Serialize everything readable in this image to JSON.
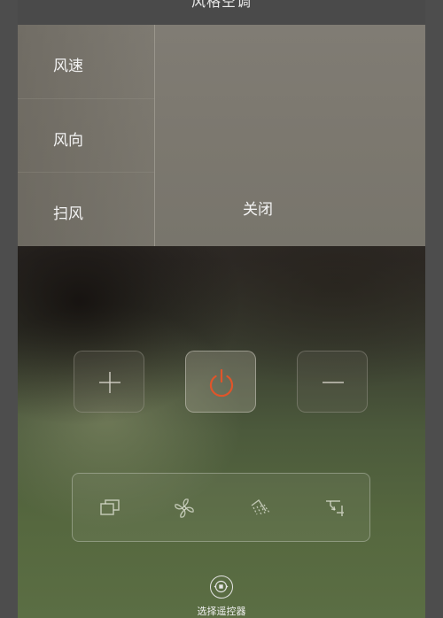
{
  "header": {
    "title": "风格空调"
  },
  "menu": {
    "items": [
      {
        "label": "风速"
      },
      {
        "label": "风向"
      },
      {
        "label": "扫风"
      }
    ],
    "selected_value": "关闭"
  },
  "controls": {
    "increase_icon": "plus-icon",
    "power_icon": "power-icon",
    "decrease_icon": "minus-icon",
    "power_color": "#e0552a"
  },
  "modes": {
    "icons": [
      "window-mode-icon",
      "fan-icon",
      "swing-icon",
      "timer-icon"
    ]
  },
  "footer": {
    "remote_label": "选择遥控器"
  }
}
